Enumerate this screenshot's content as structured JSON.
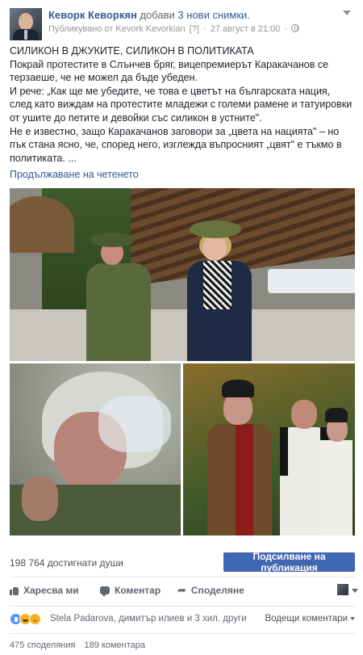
{
  "header": {
    "author": "Кеворк Кеворкян",
    "action_text": "добави",
    "action_link": "3 нови снимки.",
    "published_by": "Публикувано от Kevork Kevorkian",
    "help_marker": "[?]",
    "separator": "·",
    "timestamp": "27 август в 21:00",
    "separator2": "·"
  },
  "post": {
    "title": "СИЛИКОН В ДЖУКИТЕ, СИЛИКОН В ПОЛИТИКАТА",
    "paragraph1": "Покрай протестите в Слънчев бряг, вицепремиерът Каракачанов се терзаеше, че не можел да бъде убеден.",
    "paragraph2": "И рече: „Как ще ме убедите, че това е цветът на българската нация, след като виждам на протестите младежи с големи рамене и татуировки от ушите до петите и девойки със силикон в устните\".",
    "paragraph3": "Не е известно, защо Каракачанов заговори за „цвета на нацията\" – но пък стана ясно, че, според него, изглежда въпросният „цвят\" е тъкмо в политиката. ...",
    "read_more": "Продължаване на четенето"
  },
  "stats": {
    "reach": "198 764 достигнати души",
    "boost_button": "Подсилване на публикация"
  },
  "actions": {
    "like": "Харесва ми",
    "comment": "Коментар",
    "share": "Споделяне"
  },
  "reactions": {
    "icons": [
      "like-icon",
      "haha-icon",
      "sad-icon"
    ],
    "summary": "Stela Padarova, димитър илиев и 3 хил. други",
    "sort": "Водещи коментари"
  },
  "counts": {
    "shares": "475 споделяния",
    "comments": "189 коментара"
  },
  "colors": {
    "link": "#365899",
    "primary_button": "#4267b2",
    "secondary_text": "#616770"
  }
}
